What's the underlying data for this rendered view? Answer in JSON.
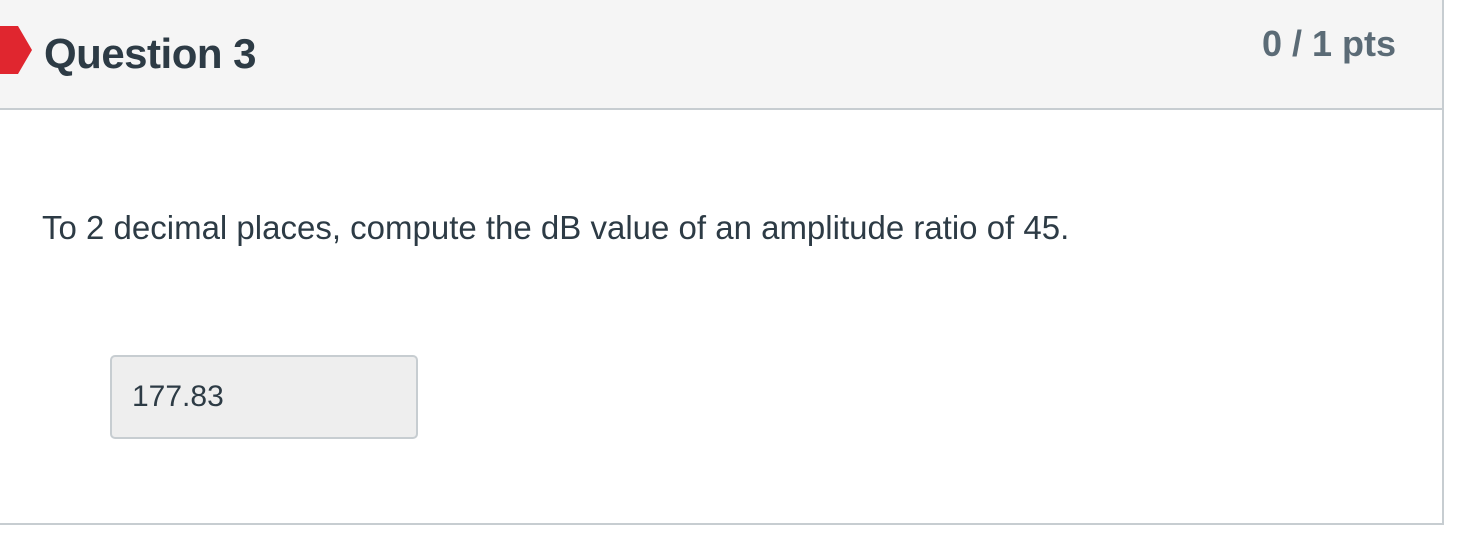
{
  "question": {
    "title": "Question 3",
    "points": "0 / 1 pts",
    "status_icon": "incorrect-flag-icon",
    "flag_color": "#e0262f",
    "text": "To 2 decimal places, compute the dB value of an amplitude ratio of 45.",
    "answer_value": "177.83"
  }
}
